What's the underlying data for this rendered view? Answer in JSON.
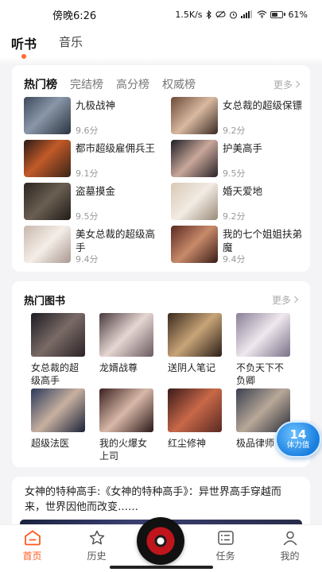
{
  "status_bar": {
    "time": "傍晚6:26",
    "speed": "1.5K/s",
    "battery": "61",
    "battery_fraction": 0.61,
    "icons": [
      "bluetooth-icon",
      "mute-icon",
      "alarm-icon",
      "signal-icon",
      "wifi-icon",
      "battery-icon"
    ]
  },
  "top_tabs": [
    {
      "label": "听书",
      "active": true
    },
    {
      "label": "音乐",
      "active": false
    }
  ],
  "ranking": {
    "tabs": [
      {
        "label": "热门榜",
        "active": true
      },
      {
        "label": "完结榜",
        "active": false
      },
      {
        "label": "高分榜",
        "active": false
      },
      {
        "label": "权威榜",
        "active": false
      }
    ],
    "more_label": "更多",
    "items": [
      {
        "title": "九极战神",
        "score": "9.6分"
      },
      {
        "title": "女总裁的超级保镖",
        "score": "9.2分"
      },
      {
        "title": "都市超级雇佣兵王",
        "score": "9.1分"
      },
      {
        "title": "护美高手",
        "score": "9.5分"
      },
      {
        "title": "盗墓摸金",
        "score": "9.5分"
      },
      {
        "title": "婚天爱地",
        "score": "9.2分"
      },
      {
        "title": "美女总裁的超级高手",
        "score": "9.4分"
      },
      {
        "title": "我的七个姐姐扶弟魔",
        "score": "9.4分"
      }
    ]
  },
  "hot_books": {
    "title": "热门图书",
    "more_label": "更多",
    "items": [
      {
        "title": "女总裁的超级高手"
      },
      {
        "title": "龙婿战尊"
      },
      {
        "title": "送阴人笔记"
      },
      {
        "title": "不负天下不负卿"
      },
      {
        "title": "超级法医"
      },
      {
        "title": "我的火爆女上司"
      },
      {
        "title": "红尘修神"
      },
      {
        "title": "极品律师"
      }
    ]
  },
  "story": {
    "text": "女神的特种高手:《女神的特种高手》：异世界高手穿越而来，世界因他而改变……"
  },
  "badge": {
    "value": "14",
    "label": "体力值"
  },
  "bottom_nav": [
    {
      "label": "首页",
      "icon": "home-icon",
      "active": true
    },
    {
      "label": "历史",
      "icon": "star-icon",
      "active": false
    },
    {
      "label": "",
      "icon": "record-disc-icon",
      "active": false
    },
    {
      "label": "任务",
      "icon": "task-list-icon",
      "active": false
    },
    {
      "label": "我的",
      "icon": "profile-icon",
      "active": false
    }
  ],
  "colors": {
    "accent": "#ff5a1f",
    "badge": "#1a7fe0"
  }
}
